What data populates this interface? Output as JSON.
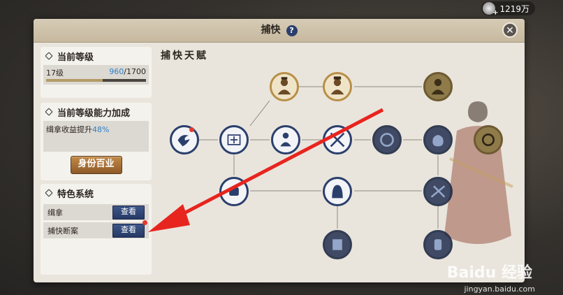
{
  "top": {
    "currency": "1219万"
  },
  "window": {
    "title": "捕快",
    "help": "?",
    "close": "✕"
  },
  "level_card": {
    "header": "当前等级",
    "level_label": "17级",
    "exp_current": "960",
    "exp_sep_max": "/1700",
    "progress": 0.565
  },
  "bonus_card": {
    "header": "当前等级能力加成",
    "text": "缉拿收益提升",
    "pct": "48%",
    "button": "身份百业"
  },
  "feature_card": {
    "header": "特色系统",
    "items": [
      {
        "label": "缉拿",
        "button": "查看"
      },
      {
        "label": "捕快断案",
        "button": "查看"
      }
    ]
  },
  "tree": {
    "title": "捕快天赋"
  },
  "watermark": {
    "main": "Baidu 经验",
    "sub": "jingyan.baidu.com"
  },
  "colors": {
    "accent_blue": "#2f7fc8",
    "node_blue": "#2b3f6d",
    "node_gold": "#b88f48",
    "arrow_red": "#e8241e"
  }
}
